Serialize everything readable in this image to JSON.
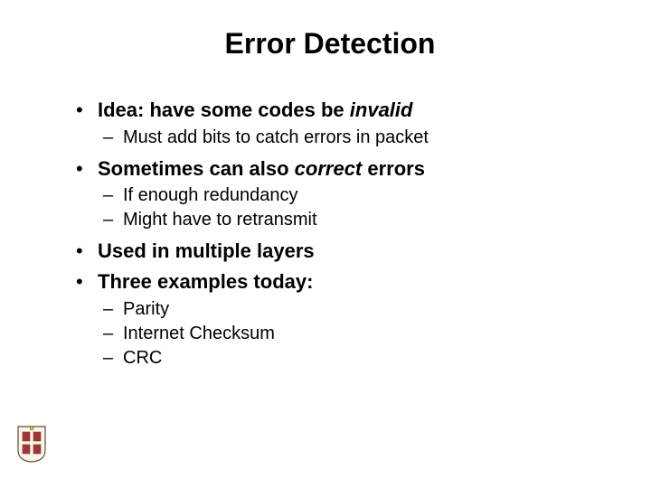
{
  "title": "Error Detection",
  "bullets": [
    {
      "main_pre": "Idea: have some codes be ",
      "main_em": "invalid",
      "main_post": "",
      "subs": [
        "Must add bits to catch errors in packet"
      ]
    },
    {
      "main_pre": "Sometimes can also ",
      "main_em": "correct",
      "main_post": " errors",
      "subs": [
        "If enough redundancy",
        "Might have to retransmit"
      ]
    },
    {
      "main_pre": "Used in multiple layers",
      "main_em": "",
      "main_post": "",
      "subs": []
    },
    {
      "main_pre": "Three examples today:",
      "main_em": "",
      "main_post": "",
      "subs": [
        "Parity",
        "Internet Checksum",
        "CRC"
      ]
    }
  ],
  "logo": {
    "name": "brown-university-crest"
  }
}
